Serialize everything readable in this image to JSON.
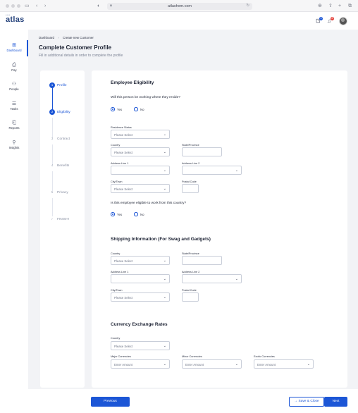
{
  "browser": {
    "url": "atlashxm.com",
    "icons": {
      "lock": "lock-icon",
      "reload": "reload-icon"
    }
  },
  "brand": {
    "small": "••••",
    "name": "atlas"
  },
  "topbar": {
    "notification_count": "3",
    "alert_count": "8"
  },
  "nav": [
    {
      "label": "Dashboard",
      "icon": "dashboard-icon",
      "glyph": "⊞"
    },
    {
      "label": "Pay",
      "icon": "pay-icon",
      "glyph": "⎙"
    },
    {
      "label": "People",
      "icon": "people-icon",
      "glyph": "⚇"
    },
    {
      "label": "Tasks",
      "icon": "tasks-icon",
      "glyph": "☰"
    },
    {
      "label": "Reports",
      "icon": "reports-icon",
      "glyph": "⎗"
    },
    {
      "label": "Insights",
      "icon": "insights-icon",
      "glyph": "⚲"
    }
  ],
  "breadcrumb": {
    "home": "Dashboard",
    "sep": "›",
    "current": "Create new Customer"
  },
  "page": {
    "title": "Complete Customer Profile",
    "subtitle": "Fill in additional details in order to complete the profile"
  },
  "steps": [
    {
      "num": "1",
      "label": "Profile",
      "state": "active"
    },
    {
      "num": "2",
      "label": "Eligibility",
      "state": "active"
    },
    {
      "num": "3",
      "label": "Contract",
      "state": "pending"
    },
    {
      "num": "4",
      "label": "Benefits",
      "state": "pending"
    },
    {
      "num": "5",
      "label": "Privacy",
      "state": "pending"
    },
    {
      "num": "✓",
      "label": "FINISH!",
      "state": "pending"
    }
  ],
  "eligibility": {
    "title": "Employee Eligibility",
    "q1": "Will this person be working where they reside?",
    "yes": "Yes",
    "no": "No",
    "residence_status_label": "Residence Status",
    "country_label": "Country",
    "state_label": "State/Province",
    "address1_label": "Address Line 1",
    "address2_label": "Address Line 2",
    "city_label": "City/Town",
    "postal_label": "Postal Code",
    "placeholder": "Please Select",
    "q2": "Is this employee eligible to work from this country?"
  },
  "shipping": {
    "title": "Shipping Information (For Swag and Gadgets)",
    "country_label": "Country",
    "state_label": "State/Province",
    "address1_label": "Address Line 1",
    "address2_label": "Address Line 2",
    "city_label": "City/Town",
    "postal_label": "Postal Code",
    "placeholder": "Please Select"
  },
  "currency": {
    "title": "Currency Exchange Rates",
    "country_label": "Country",
    "placeholder": "Please Select",
    "major_label": "Major Currencies",
    "minor_label": "Minor Currencies",
    "exotic_label": "Exotic Currencies",
    "amount_placeholder": "Enter Amount"
  },
  "footer": {
    "previous": "Previous",
    "save_close": "Save & Close",
    "next": "Next"
  }
}
